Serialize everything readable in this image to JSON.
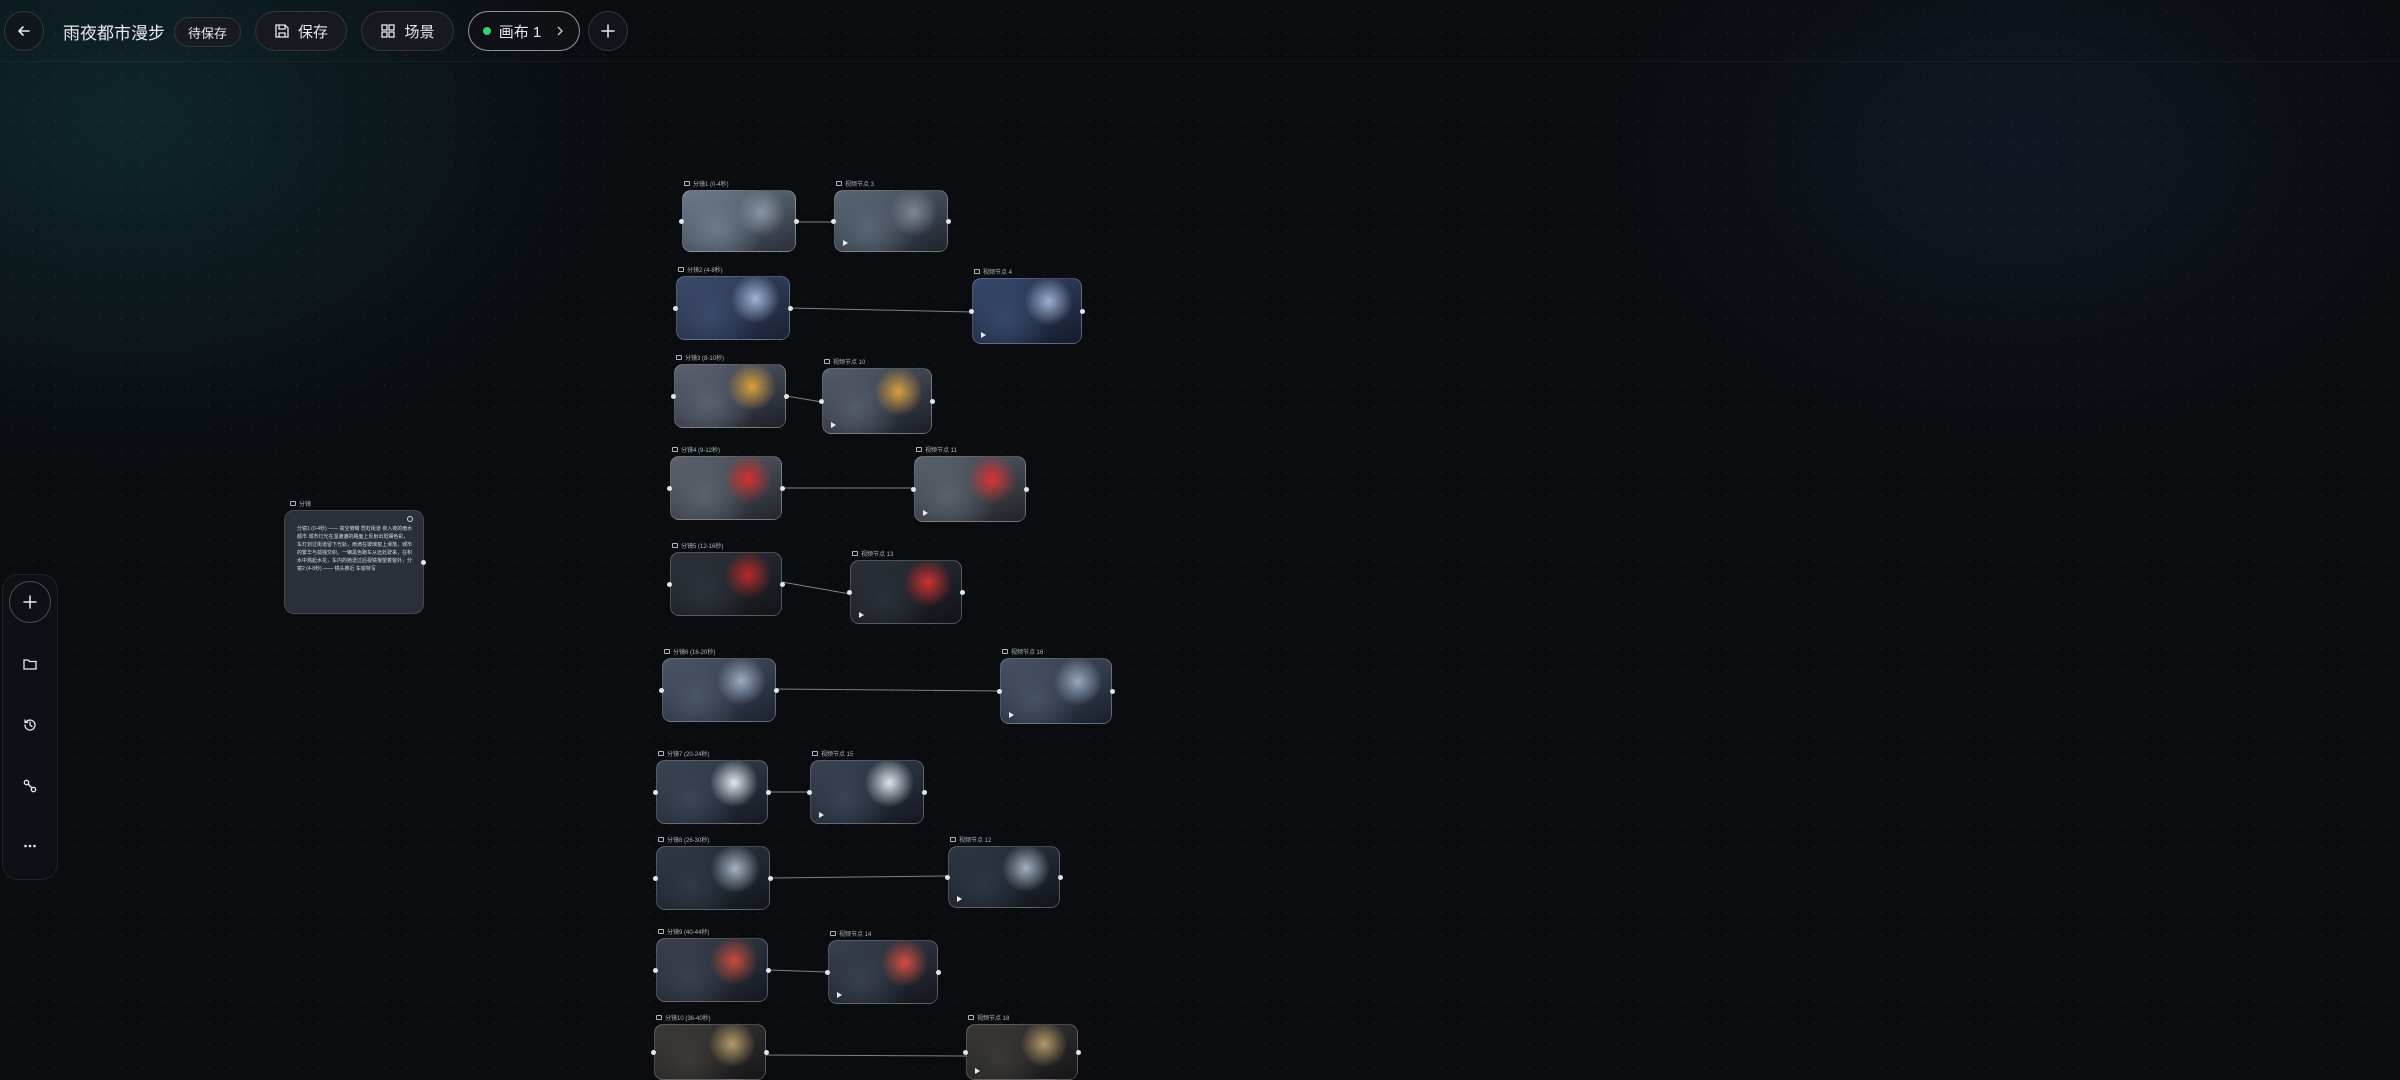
{
  "header": {
    "project_title": "雨夜都市漫步",
    "save_status": "待保存",
    "save_label": "保存",
    "scene_label": "场景",
    "canvas_tab_label": "画布 1"
  },
  "text_node": {
    "label": "分镜",
    "content": "分镜1 (0-4秒) —— 高空俯瞰 霓虹街道 夜入夜的雨水都市 城市灯光在湿漉漉的路面上反射出斑斓色彩，车灯划过街道留下光轨，雨滴在玻璃窗上滑落，城市的繁华与孤独交织。一辆黑色跑车从远处驶来，在积水中溅起水花，车内的她透过后视镜凝望着窗外，分镜2 (4-8秒) —— 镜头推近 车窗特写"
  },
  "nodes": [
    {
      "label": "分镜1 (0-4秒)",
      "gen_label": "视频节点 3"
    },
    {
      "label": "分镜2 (4-8秒)",
      "gen_label": "视频节点 4"
    },
    {
      "label": "分镜3 (8-10秒)",
      "gen_label": "视频节点 10"
    },
    {
      "label": "分镜4 (9-12秒)",
      "gen_label": "视频节点 11"
    },
    {
      "label": "分镜5 (12-16秒)",
      "gen_label": "视频节点 13"
    },
    {
      "label": "分镜6 (16-20秒)",
      "gen_label": "视频节点 16"
    },
    {
      "label": "分镜7 (20-24秒)",
      "gen_label": "视频节点 15"
    },
    {
      "label": "分镜8 (26-30秒)",
      "gen_label": "视频节点 12"
    },
    {
      "label": "分镜9 (40-44秒)",
      "gen_label": "视频节点 14"
    },
    {
      "label": "分镜10 (36-40秒)",
      "gen_label": "视频节点 18"
    }
  ],
  "sidebar": {
    "items": [
      "add-icon",
      "folder-icon",
      "history-icon",
      "workflow-icon",
      "more-icon"
    ]
  },
  "colors": {
    "accent_green": "#33d17a",
    "background": "#0a0c10"
  }
}
